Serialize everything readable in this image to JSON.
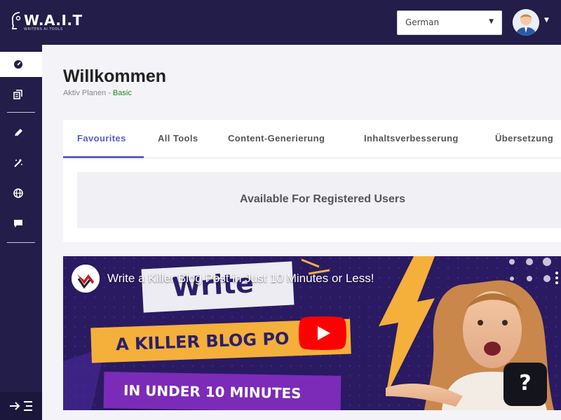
{
  "header": {
    "logo_text": "W.A.I.T",
    "logo_tagline": "WRITERS AI TOOLS",
    "language": {
      "selected": "German"
    }
  },
  "sidebar": {
    "items": [
      {
        "icon": "dashboard-icon",
        "active": true
      },
      {
        "icon": "documents-icon",
        "active": false
      },
      {
        "icon": "pen-icon",
        "active": false
      },
      {
        "icon": "magic-wand-icon",
        "active": false
      },
      {
        "icon": "globe-icon",
        "active": false
      },
      {
        "icon": "chat-icon",
        "active": false
      }
    ],
    "collapse_icon": "collapse-menu-icon"
  },
  "main": {
    "title": "Willkommen",
    "plan_label": "Aktiv Planen -",
    "plan_value": "Basic",
    "tabs": [
      {
        "label": "Favourites",
        "active": true
      },
      {
        "label": "All Tools",
        "active": false
      },
      {
        "label": "Content-Generierung",
        "active": false
      },
      {
        "label": "Inhaltsverbesserung",
        "active": false
      },
      {
        "label": "Übersetzung",
        "active": false
      }
    ],
    "notice": "Available For Registered Users"
  },
  "video": {
    "title": "Write a Killer Blog Post in Just 10 Minutes or Less!",
    "thumbnail_text": [
      "Write",
      "A KILLER BLOG PO",
      "IN UNDER 10 MINUTES"
    ],
    "play_icon": "youtube-play-icon"
  },
  "help": {
    "label": "?"
  },
  "colors": {
    "sidebar_bg": "#221d49",
    "accent": "#5b5bd6",
    "plan_green": "#1a8a1a"
  }
}
